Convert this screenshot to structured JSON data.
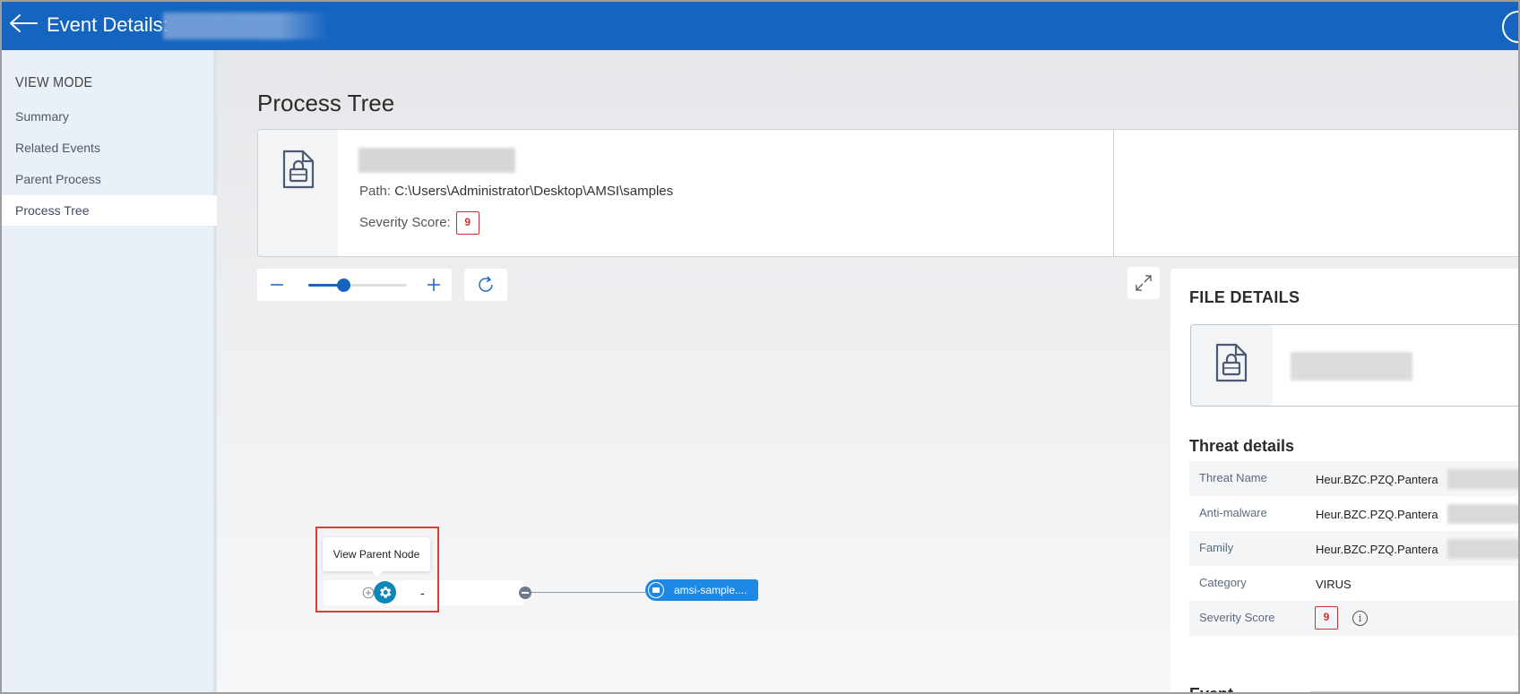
{
  "header": {
    "title": "Event Details:",
    "back_icon": "arrow-left-icon"
  },
  "sidebar": {
    "heading": "VIEW MODE",
    "items": [
      {
        "label": "Summary",
        "active": false
      },
      {
        "label": "Related Events",
        "active": false
      },
      {
        "label": "Parent Process",
        "active": false
      },
      {
        "label": "Process Tree",
        "active": true
      }
    ]
  },
  "main": {
    "title": "Process Tree",
    "process": {
      "path_label": "Path:",
      "path_value": "C:\\Users\\Administrator\\Desktop\\AMSI\\samples",
      "severity_label": "Severity Score:",
      "severity_value": "9"
    },
    "zoom": {
      "level": 0.35
    },
    "tree": {
      "tooltip": "View Parent Node",
      "root_label": "-",
      "child_label": "amsi-sample...."
    }
  },
  "file_details": {
    "title": "FILE DETAILS",
    "threat_heading": "Threat details",
    "rows": [
      {
        "key": "Threat Name",
        "value": "Heur.BZC.PZQ.Pantera"
      },
      {
        "key": "Anti-malware",
        "value": "Heur.BZC.PZQ.Pantera"
      },
      {
        "key": "Family",
        "value": "Heur.BZC.PZQ.Pantera"
      },
      {
        "key": "Category",
        "value": "VIRUS"
      },
      {
        "key": "Severity Score",
        "value": "9"
      }
    ],
    "event_heading": "Event"
  },
  "colors": {
    "header_bg": "#1565c0",
    "severity": "#d32f2f",
    "node_child": "#1e88e5",
    "highlight": "#e53935"
  }
}
